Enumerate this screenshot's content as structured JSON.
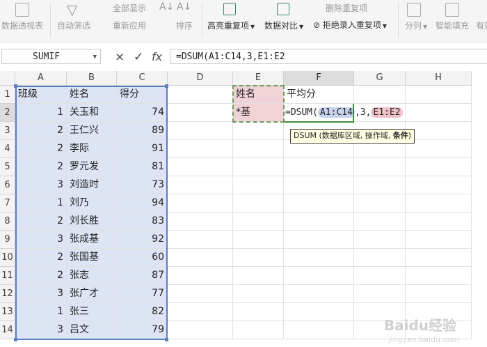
{
  "ribbon": {
    "items": [
      {
        "label": "数据透视表"
      },
      {
        "label": "自动筛选"
      },
      {
        "label": "全部显示"
      },
      {
        "label": "重新应用"
      },
      {
        "label": "排序"
      },
      {
        "label": "高亮重复项"
      },
      {
        "label": "数据对比"
      },
      {
        "label": "删除重复项"
      },
      {
        "label": "拒绝录入重复项"
      },
      {
        "label": "分列"
      },
      {
        "label": "智能填充"
      },
      {
        "label": "有效"
      }
    ]
  },
  "formula_bar": {
    "name_box": "SUMIF",
    "cancel_icon": "×",
    "confirm_icon": "✓",
    "fx_icon": "fx",
    "formula": "=DSUM(A1:C14,3,E1:E2"
  },
  "grid": {
    "columns": [
      "A",
      "B",
      "C",
      "D",
      "E",
      "F",
      "G",
      "H"
    ],
    "rows": [
      "1",
      "2",
      "3",
      "4",
      "5",
      "6",
      "7",
      "8",
      "9",
      "10",
      "11",
      "12",
      "13",
      "14"
    ],
    "headers": {
      "a": "班级",
      "b": "姓名",
      "c": "得分"
    },
    "data": [
      {
        "a": "1",
        "b": "关玉和",
        "c": "74"
      },
      {
        "a": "2",
        "b": "王仁兴",
        "c": "89"
      },
      {
        "a": "2",
        "b": "李际",
        "c": "91"
      },
      {
        "a": "2",
        "b": "罗元发",
        "c": "81"
      },
      {
        "a": "3",
        "b": "刘造时",
        "c": "73"
      },
      {
        "a": "1",
        "b": "刘乃",
        "c": "94"
      },
      {
        "a": "2",
        "b": "刘长胜",
        "c": "83"
      },
      {
        "a": "3",
        "b": "张成基",
        "c": "92"
      },
      {
        "a": "2",
        "b": "张国基",
        "c": "60"
      },
      {
        "a": "2",
        "b": "张志",
        "c": "87"
      },
      {
        "a": "3",
        "b": "张广才",
        "c": "77"
      },
      {
        "a": "1",
        "b": "张三",
        "c": "82"
      },
      {
        "a": "3",
        "b": "吕文",
        "c": "79"
      }
    ],
    "e1": "姓名",
    "e2": "*基",
    "f1": "平均分",
    "f2_parts": {
      "prefix": "=DSUM(",
      "ref1": "A1:C14",
      "mid": ",3,",
      "ref2": "E1:E2"
    }
  },
  "tooltip": {
    "prefix": "DSUM (数据库区域, 操作域, ",
    "bold": "条件",
    "suffix": ")"
  },
  "watermark": {
    "text": "Baidu经验",
    "sub": "jingyan.baidu.com"
  }
}
